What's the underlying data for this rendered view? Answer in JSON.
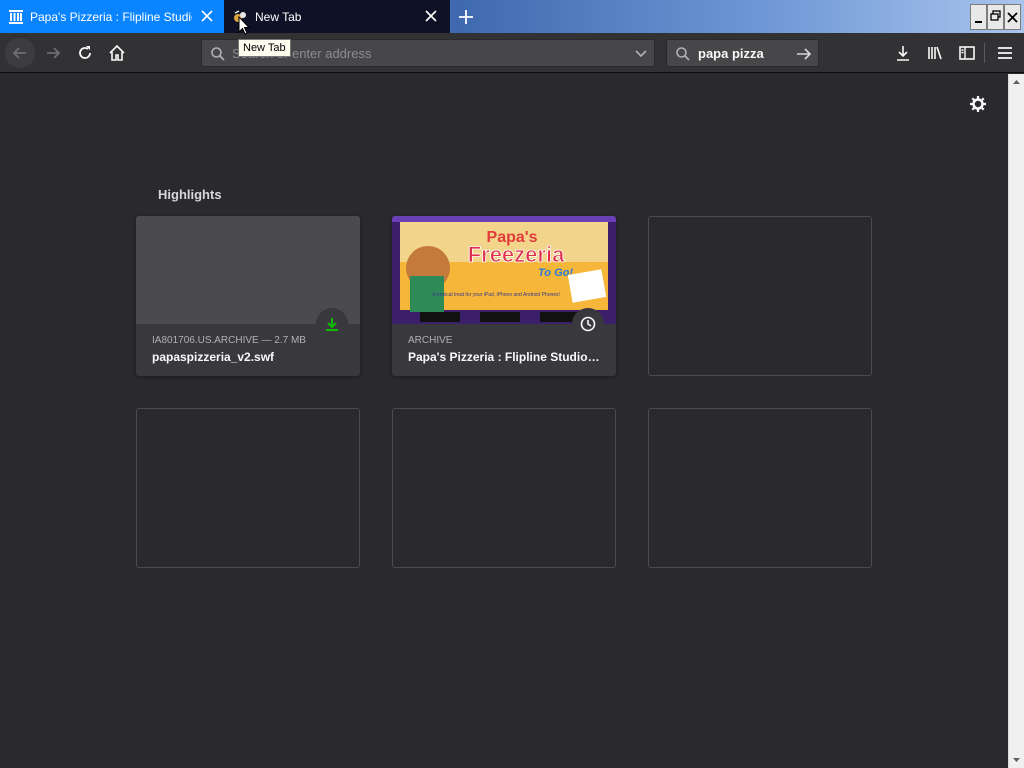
{
  "tabs": [
    {
      "title": "Papa's Pizzeria : Flipline Studios : F",
      "icon": "archive-museum-icon",
      "active": false
    },
    {
      "title": "New Tab",
      "icon": "new-tab-icon",
      "active": true
    }
  ],
  "tooltip": "New Tab",
  "urlbar": {
    "placeholder": "Search or enter address"
  },
  "searchbar": {
    "query": "papa pizza"
  },
  "highlights": {
    "title": "Highlights",
    "cards": [
      {
        "context": "IA801706.US.ARCHIVE — 2.7 MB",
        "title": "papaspizzeria_v2.swf",
        "badge": "download-icon",
        "badge_color": "#12bc00"
      },
      {
        "context": "ARCHIVE",
        "title": "Papa's Pizzeria : Flipline Studios : Free Download, Borrow, and Streaming",
        "badge": "clock-icon",
        "thumb": {
          "brand": "Papa's",
          "game": "Freezeria",
          "tag": "To Go!",
          "caption": "A tropical treat for your iPad, iPhone and Android Phones!"
        }
      }
    ]
  },
  "colors": {
    "accent": "#0a84ff",
    "background": "#2a2a2e",
    "toolbar": "#323234"
  }
}
